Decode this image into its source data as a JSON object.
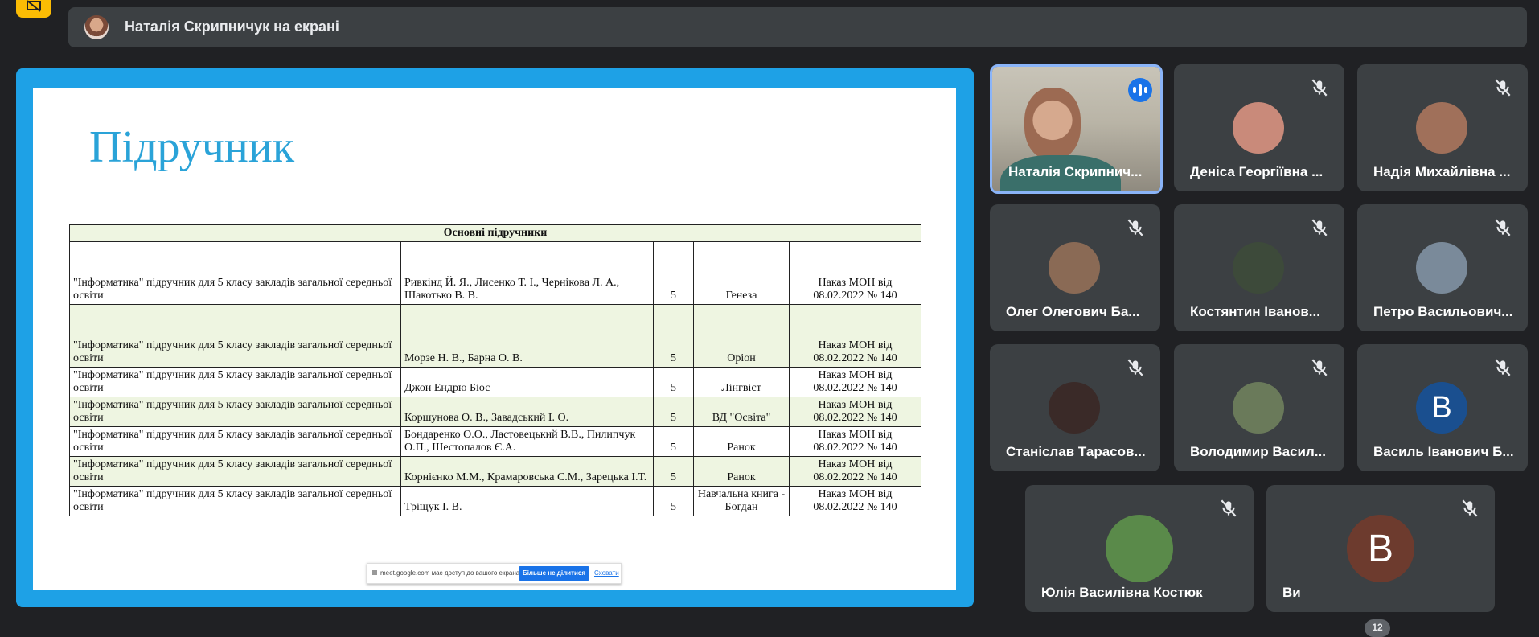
{
  "presenter": {
    "text": "Наталія Скрипничук на екрані"
  },
  "slide": {
    "title": "Підручник",
    "table_header": "Основні підручники",
    "rows": [
      {
        "title": "\"Інформатика\" підручник для 5 класу закладів загальної середньої освіти",
        "authors": "Ривкінд Й. Я., Лисенко Т. І., Чернікова Л. А., Шакотько В. В.",
        "grade": "5",
        "publisher": "Генеза",
        "order": "Наказ МОН від 08.02.2022 № 140"
      },
      {
        "title": "\"Інформатика\" підручник для 5 класу закладів загальної середньої освіти",
        "authors": "Морзе Н. В., Барна О. В.",
        "grade": "5",
        "publisher": "Оріон",
        "order": "Наказ МОН від 08.02.2022 № 140"
      },
      {
        "title": "\"Інформатика\" підручник для 5 класу закладів загальної середньої освіти",
        "authors": "Джон Ендрю Біос",
        "grade": "5",
        "publisher": "Лінгвіст",
        "order": "Наказ МОН від 08.02.2022 № 140"
      },
      {
        "title": "\"Інформатика\" підручник для 5 класу закладів загальної середньої освіти",
        "authors": "Коршунова О. В., Завадський І. О.",
        "grade": "5",
        "publisher": "ВД \"Освіта\"",
        "order": "Наказ МОН від 08.02.2022 № 140"
      },
      {
        "title": "\"Інформатика\" підручник для 5 класу закладів загальної середньої освіти",
        "authors": "Бондаренко О.О., Ластовецький В.В., Пилипчук О.П., Шестопалов Є.А.",
        "grade": "5",
        "publisher": "Ранок",
        "order": "Наказ МОН від 08.02.2022 № 140"
      },
      {
        "title": "\"Інформатика\" підручник для 5 класу закладів загальної середньої освіти",
        "authors": "Корнієнко М.М., Крамаровська С.М., Зарецька І.Т.",
        "grade": "5",
        "publisher": "Ранок",
        "order": "Наказ МОН від 08.02.2022 № 140"
      },
      {
        "title": "\"Інформатика\" підручник для 5 класу закладів загальної середньої освіти",
        "authors": "Тріщук І. В.",
        "grade": "5",
        "publisher": "Навчальна книга - Богдан",
        "order": "Наказ МОН від 08.02.2022 № 140"
      }
    ]
  },
  "share_notice": {
    "text": "meet.google.com має доступ до вашого екрана.",
    "stop_button": "Більше не ділитися",
    "hide_link": "Сховати"
  },
  "participants": [
    {
      "name": "Наталія Скрипнич...",
      "avatar_color": "#b5a08a"
    },
    {
      "name": "Деніса Георгіївна ...",
      "avatar_color": "#c98a7a"
    },
    {
      "name": "Надія Михайлівна ...",
      "avatar_color": "#a0705a"
    },
    {
      "name": "Олег Олегович Ба...",
      "avatar_color": "#8a6a55"
    },
    {
      "name": "Костянтин Іванов...",
      "avatar_color": "#3d4a3a"
    },
    {
      "name": "Петро Васильович...",
      "avatar_color": "#7a8a9a"
    },
    {
      "name": "Станіслав Тарасов...",
      "avatar_color": "#3a2a28"
    },
    {
      "name": "Володимир Васил...",
      "avatar_color": "#6a7a5a"
    },
    {
      "name": "Василь Іванович Б...",
      "avatar_letter": "В",
      "avatar_color": "#1a4f8f"
    },
    {
      "name": "Юлія Василівна Костюк",
      "avatar_color": "#5a8a4a"
    },
    {
      "name": "Ви",
      "avatar_letter": "В",
      "avatar_color": "#6d3b2e"
    }
  ],
  "participant_count": "12",
  "colors": {
    "background": "#202124",
    "tile": "#3c4043",
    "share_border": "#1ea1e6",
    "accent": "#1a73e8"
  }
}
